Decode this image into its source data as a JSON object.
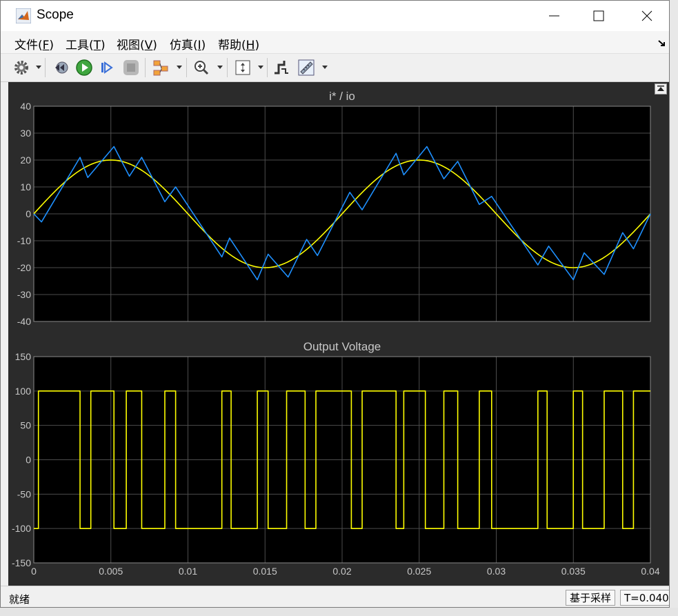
{
  "window": {
    "title": "Scope",
    "controls": [
      "minimize",
      "maximize",
      "close"
    ]
  },
  "menu": [
    {
      "label": "文件(",
      "key": "F",
      "tail": ")"
    },
    {
      "label": "工具(",
      "key": "T",
      "tail": ")"
    },
    {
      "label": "视图(",
      "key": "V",
      "tail": ")"
    },
    {
      "label": "仿真(",
      "key": "I",
      "tail": ")"
    },
    {
      "label": "帮助(",
      "key": "H",
      "tail": ")"
    }
  ],
  "toolbar": {
    "icons": [
      "gear-icon",
      "step-back-icon",
      "run-icon",
      "step-forward-icon",
      "stop-icon",
      "highlight-block-icon",
      "zoom-in-icon",
      "autoscale-icon",
      "triggers-icon",
      "measurements-icon"
    ]
  },
  "status": {
    "text": "就绪",
    "sample_mode": "基于采样",
    "time": "T=0.040"
  },
  "colors": {
    "plot_bg": "#000000",
    "figure_bg": "#2b2b2b",
    "axis_text": "#c8c8c8",
    "reference": "#ffff00",
    "current": "#1e90ff",
    "voltage": "#ffff00"
  },
  "chart_data": [
    {
      "type": "line",
      "title": "i* / io",
      "xlim": [
        0,
        0.04
      ],
      "ylim": [
        -40,
        40
      ],
      "x_ticks": [
        0,
        0.005,
        0.01,
        0.015,
        0.02,
        0.025,
        0.03,
        0.035,
        0.04
      ],
      "y_ticks": [
        40,
        30,
        20,
        10,
        0,
        -10,
        -20,
        -30,
        -40
      ],
      "show_x_tick_labels": false,
      "grid": true,
      "series": [
        {
          "kind": "reference-sine",
          "color": "#ffff00",
          "amplitude": 20,
          "frequency_hz": 50
        },
        {
          "kind": "current",
          "color": "#1e90ff",
          "x": [
            0,
            0.0005,
            0.003,
            0.0035,
            0.0052,
            0.0062,
            0.007,
            0.0085,
            0.0092,
            0.0122,
            0.0127,
            0.0145,
            0.0152,
            0.0165,
            0.0177,
            0.0184,
            0.0205,
            0.0213,
            0.0235,
            0.024,
            0.0255,
            0.0266,
            0.0275,
            0.0289,
            0.0297,
            0.0327,
            0.0334,
            0.035,
            0.0357,
            0.037,
            0.0382,
            0.0389,
            0.04
          ],
          "y": [
            0,
            -3,
            21,
            13.5,
            25,
            14,
            21,
            4.5,
            10,
            -16,
            -9,
            -24.5,
            -15,
            -23.5,
            -9.5,
            -15.5,
            8,
            1.5,
            22.5,
            14.5,
            25,
            13,
            19.5,
            3.5,
            6.5,
            -19,
            -12,
            -24.5,
            -14.5,
            -22.5,
            -7,
            -13,
            0
          ]
        }
      ]
    },
    {
      "type": "line",
      "title": "Output Voltage",
      "xlim": [
        0,
        0.04
      ],
      "ylim": [
        -150,
        150
      ],
      "x_ticks": [
        0,
        0.005,
        0.01,
        0.015,
        0.02,
        0.025,
        0.03,
        0.035,
        0.04
      ],
      "x_tick_labels": [
        "0",
        "0.005",
        "0.01",
        "0.015",
        "0.02",
        "0.025",
        "0.03",
        "0.035",
        "0.04"
      ],
      "y_ticks": [
        150,
        100,
        50,
        0,
        -50,
        -100,
        -150
      ],
      "grid": true,
      "series": [
        {
          "kind": "voltage",
          "color": "#ffff00",
          "initial": -100,
          "transitions": [
            0.0003,
            0.003,
            0.0037,
            0.0052,
            0.006,
            0.007,
            0.0085,
            0.0092,
            0.0122,
            0.0128,
            0.0145,
            0.0152,
            0.0164,
            0.0176,
            0.0183,
            0.0206,
            0.0213,
            0.0235,
            0.024,
            0.0254,
            0.0266,
            0.0275,
            0.0289,
            0.0297,
            0.0327,
            0.0333,
            0.035,
            0.0356,
            0.037,
            0.0382,
            0.0389,
            0.04
          ],
          "levels": [
            100,
            -100
          ]
        }
      ]
    }
  ]
}
